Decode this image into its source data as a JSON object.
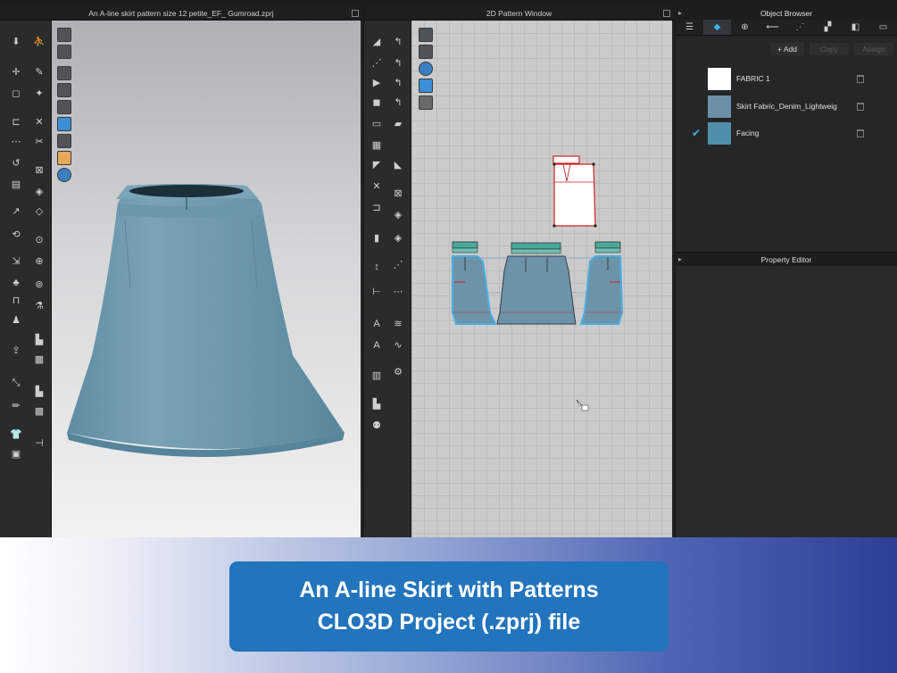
{
  "window_3d": {
    "title": "An A-line skirt pattern size 12 petite_EF_ Gumroad.zprj"
  },
  "window_2d": {
    "title": "2D Pattern Window"
  },
  "object_browser": {
    "title": "Object Browser",
    "tabs": [
      "list-icon",
      "fabric-icon",
      "button-icon",
      "topstitch-icon",
      "stitch-icon",
      "trim-icon",
      "avatar-icon"
    ],
    "actions": {
      "add": "+ Add",
      "copy": "Copy",
      "assign": "Assign"
    },
    "fabrics": [
      {
        "name": "FABRIC 1",
        "swatch": "#ffffff",
        "selected": false
      },
      {
        "name": "Skirt Fabric_Denim_Lightweig",
        "swatch": "#6b90a7",
        "selected": false
      },
      {
        "name": "Facing",
        "swatch": "#4f8fab",
        "selected": true
      }
    ]
  },
  "property_editor": {
    "title": "Property Editor"
  },
  "banner": {
    "line1": "An A-line Skirt with Patterns",
    "line2": "CLO3D Project (.zprj) file"
  },
  "colors": {
    "skirt": "#6a97ac",
    "accent": "#3fb0ee",
    "banner_box": "#2274bc"
  }
}
